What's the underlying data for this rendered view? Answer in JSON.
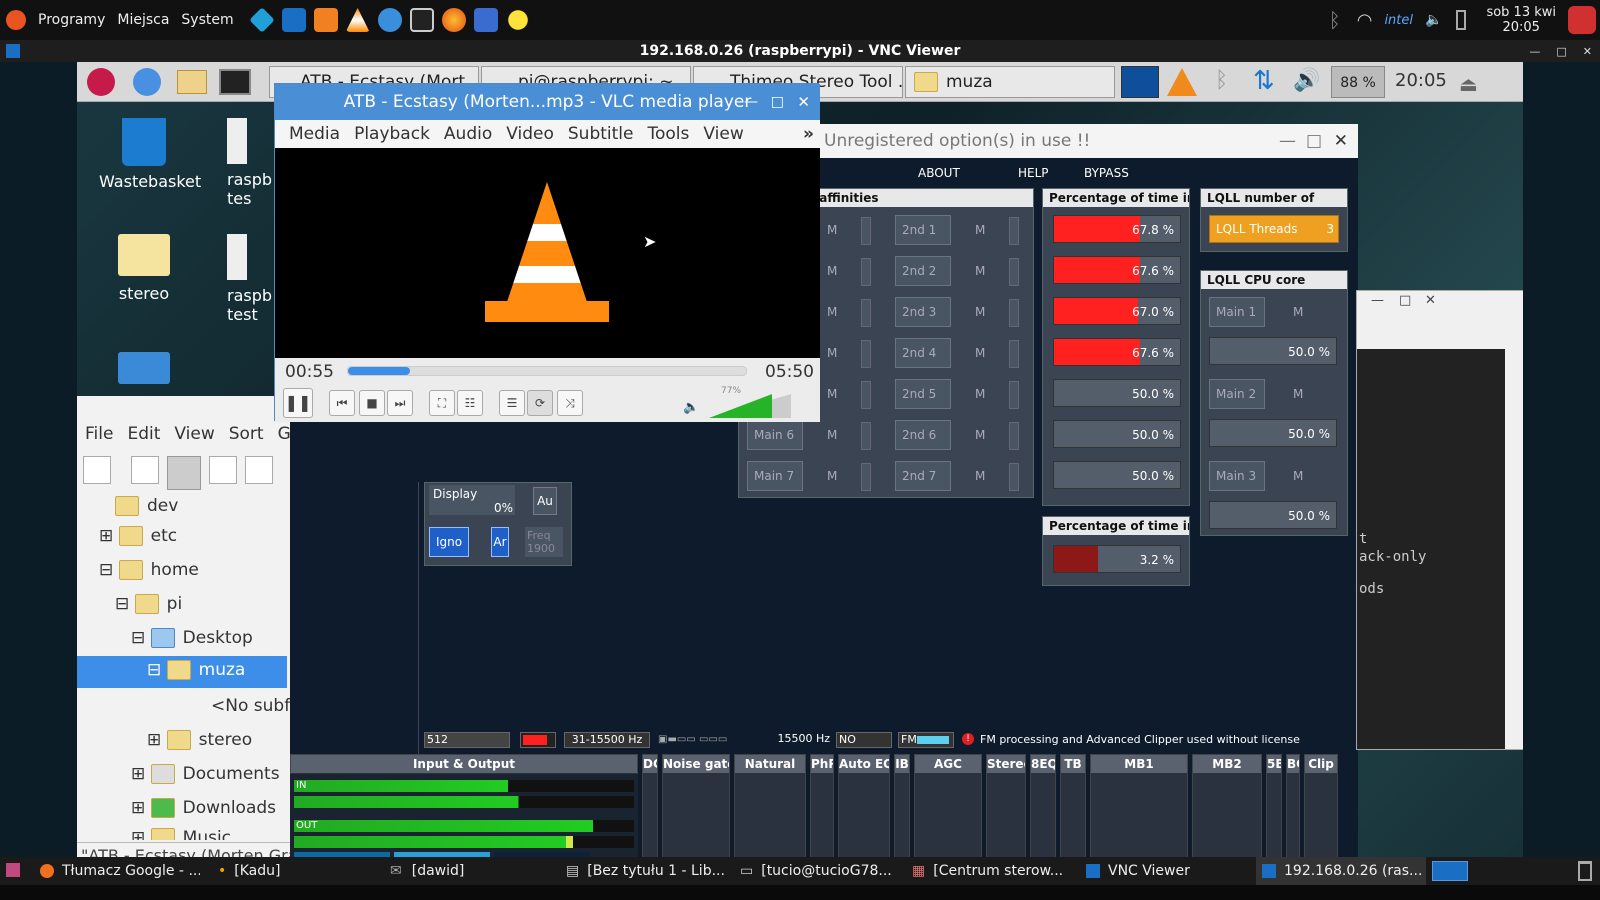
{
  "host_panel": {
    "menu": [
      "Programy",
      "Miejsca",
      "System"
    ],
    "clock_line1": "sob 13 kwi",
    "clock_line2": "20:05"
  },
  "vnc": {
    "title": "192.168.0.26 (raspberrypi) - VNC Viewer"
  },
  "remote_panel": {
    "tasks": [
      "ATB - Ecstasy (Mort...",
      "pi@raspberrypi: ~",
      "Thimeo Stereo Tool ...",
      "muza"
    ],
    "cpu": "88 %",
    "time": "20:05"
  },
  "desktop_icons": [
    "Wastebasket",
    "stereo",
    "raspb tes",
    "raspb test"
  ],
  "file_manager": {
    "menu": [
      "File",
      "Edit",
      "View",
      "Sort",
      "G"
    ],
    "tree": [
      {
        "label": "dev",
        "depth": 1
      },
      {
        "label": "etc",
        "depth": 1
      },
      {
        "label": "home",
        "depth": 1
      },
      {
        "label": "pi",
        "depth": 2
      },
      {
        "label": "Desktop",
        "depth": 3
      },
      {
        "label": "muza",
        "depth": 4,
        "selected": true
      },
      {
        "label": "<No subfo",
        "depth": 5
      },
      {
        "label": "stereo",
        "depth": 4
      },
      {
        "label": "Documents",
        "depth": 3
      },
      {
        "label": "Downloads",
        "depth": 3
      },
      {
        "label": "Music",
        "depth": 3
      }
    ],
    "status": "\"ATB - Ecstasy (Morten Gra"
  },
  "stereo_tool": {
    "title": "Unregistered option(s) in use !!",
    "menu": [
      "ABOUT",
      "HELP",
      "BYPASS"
    ],
    "cpu_affinities": {
      "header": "CPU core affinities",
      "main_labels": [
        "",
        "",
        "",
        "",
        "",
        "Main 6",
        "Main 7"
      ],
      "second_labels": [
        "2nd 1",
        "2nd 2",
        "2nd 3",
        "2nd 4",
        "2nd 5",
        "2nd 6",
        "2nd 7"
      ],
      "m_label": "M"
    },
    "percent_time": {
      "header": "Percentage of time in",
      "values": [
        "67.8 %",
        "67.6 %",
        "67.0 %",
        "67.6 %",
        "50.0 %",
        "50.0 %",
        "50.0 %"
      ],
      "fractions": [
        0.678,
        0.676,
        0.67,
        0.676,
        0,
        0,
        0
      ]
    },
    "percent_time2": {
      "header": "Percentage of time in",
      "value": "3.2 %",
      "fraction": 0.35
    },
    "lqll_threads": {
      "header": "LQLL number of",
      "label": "LQLL Threads",
      "value": "3"
    },
    "lqll_cpu": {
      "header": "LQLL CPU core",
      "rows": [
        {
          "label": "Main 1",
          "m": "M"
        },
        {
          "value": "50.0 %"
        },
        {
          "label": "Main 2",
          "m": "M"
        },
        {
          "value": "50.0 %"
        },
        {
          "label": "Main 3",
          "m": "M"
        },
        {
          "value": "50.0 %"
        }
      ]
    },
    "left_controls": {
      "display": "Display",
      "display_value": "0%",
      "au": "Au",
      "ignore": "Igno",
      "ar": "Ar",
      "freq": "Freq",
      "freq_value": "1900"
    },
    "status_bar": {
      "sr": "512",
      "band": "31-15500 Hz",
      "hz": "15500 Hz",
      "no": "NO",
      "fm": "FM",
      "warning": "FM processing and Advanced Clipper used without license"
    },
    "sections": [
      "Input & Output",
      "DC",
      "Noise gate",
      "Natural",
      "PhR",
      "Auto EQ",
      "IB",
      "AGC",
      "Stereo",
      "8EQ",
      "TB",
      "MB1",
      "MB2",
      "5B",
      "BC",
      "Clip"
    ],
    "io": {
      "in": "IN",
      "out": "OUT"
    }
  },
  "terminal_window": {
    "lines": [
      "t",
      "ack-only",
      "ods"
    ]
  },
  "vlc": {
    "title": "ATB - Ecstasy (Morten...mp3 - VLC media player",
    "menu": [
      "Media",
      "Playback",
      "Audio",
      "Video",
      "Subtitle",
      "Tools",
      "View"
    ],
    "more": "»",
    "elapsed": "00:55",
    "total": "05:50",
    "progress": 0.157,
    "volume": "77%",
    "volume_fraction": 0.77
  },
  "taskbar": {
    "tasks": [
      "Tłumacz Google - ...",
      "[Kadu]",
      "[dawid]",
      "[Bez tytułu 1 - Lib...",
      "[tucio@tucioG78...",
      "[Centrum sterow...",
      "VNC Viewer",
      "192.168.0.26 (ras..."
    ]
  },
  "colors": {
    "vlc_title": "#4a8fd6",
    "selection": "#3d8ee8",
    "meter_red": "#ff2020",
    "lqll_orange": "#f0a020"
  }
}
